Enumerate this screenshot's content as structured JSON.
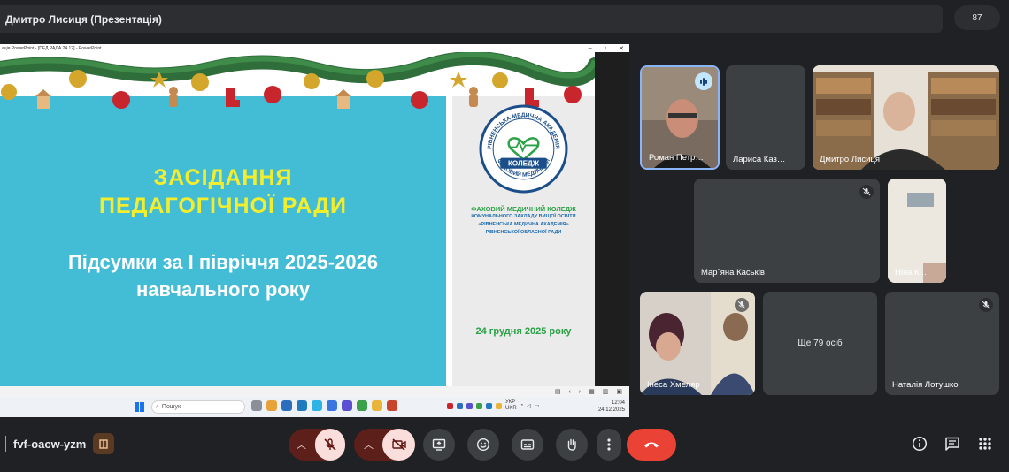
{
  "header": {
    "title": "Дмитро Лисиця (Презентація)",
    "participant_count": "87"
  },
  "presentation_window": {
    "title": "ація PowerPoint - [ПЕД РАДА 24.12] - PowerPoint",
    "slide": {
      "heading_line1": "ЗАСІДАННЯ",
      "heading_line2": "ПЕДАГОГІЧНОЇ РАДИ",
      "subtitle_line1": "Підсумки за І півріччя 2025-2026",
      "subtitle_line2": "навчального року",
      "logo_text_top": "РІВНЕНСЬКА МЕДИЧНА АКАДЕМІЯ",
      "logo_text_center": "КОЛЕДЖ",
      "logo_text_bottom": "ФАХОВИЙ МЕДИЧНИЙ",
      "college_line1": "ФАХОВИЙ МЕДИЧНИЙ КОЛЕДЖ",
      "college_line2": "КОМУНАЛЬНОГО ЗАКЛАДУ ВИЩОЇ ОСВІТИ",
      "college_line3": "«РІВНЕНСЬКА МЕДИЧНА АКАДЕМІЯ»",
      "college_line4": "РІВНЕНСЬКОЇ ОБЛАСНОЇ РАДИ",
      "date": "24 грудня 2025 року"
    },
    "taskbar": {
      "search_placeholder": "Пошук",
      "language_line1": "УКР",
      "language_line2": "UKR",
      "time": "12:04",
      "date": "24.12.2025"
    }
  },
  "participants": [
    {
      "name": "Роман Петр…"
    },
    {
      "name": "Лариса Каз…"
    },
    {
      "name": "Дмитро Лисиця"
    },
    {
      "name": "Мар`яна Каськів"
    },
    {
      "name": "Ніна Кі…"
    },
    {
      "name": "Інеса Хмеляр"
    },
    {
      "name": "Наталія Лотушко"
    }
  ],
  "more_participants": "Ще 79 осіб",
  "footer": {
    "meeting_code": "fvf-oacw-yzm"
  },
  "colors": {
    "background": "#202124",
    "tile": "#3c4043",
    "leave": "#ea4335",
    "muted": "#f9dedc",
    "slide_blue": "#43bcd6",
    "slide_heading": "#f3ee2d",
    "college_green": "#2aa245"
  }
}
